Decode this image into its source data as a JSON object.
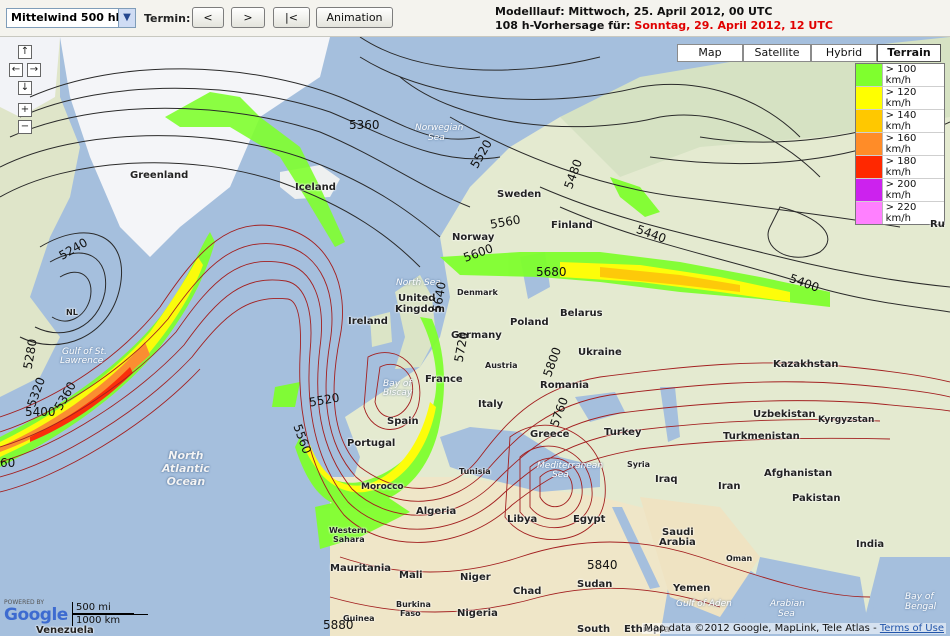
{
  "toolbar": {
    "level_select": "Mittelwind 500 hPa",
    "termin_label": "Termin:",
    "btn_prev": "<",
    "btn_next": ">",
    "btn_first": "|<",
    "btn_animation": "Animation"
  },
  "run_info": {
    "line1": "Modelllauf: Mittwoch, 25. April 2012, 00 UTC",
    "line2_prefix": "108 h-Vorhersage für:",
    "line2_date": "Sonntag, 29. April 2012, 12 UTC"
  },
  "map_types": [
    "Map",
    "Satellite",
    "Hybrid",
    "Terrain"
  ],
  "map_type_active": "Terrain",
  "legend": [
    {
      "label": "> 100 km/h",
      "color": "#7fff2e"
    },
    {
      "label": "> 120 km/h",
      "color": "#ffff00"
    },
    {
      "label": "> 140 km/h",
      "color": "#ffc800"
    },
    {
      "label": "> 160 km/h",
      "color": "#ff8c28"
    },
    {
      "label": "> 180 km/h",
      "color": "#ff2800"
    },
    {
      "label": "> 200 km/h",
      "color": "#cc22ee"
    },
    {
      "label": "> 220 km/h",
      "color": "#ff80ff"
    }
  ],
  "nav_controls": {
    "up": "↑",
    "left": "←",
    "right": "→",
    "down": "↓",
    "zoom_in": "+",
    "zoom_out": "−"
  },
  "places": {
    "greenland": "Greenland",
    "iceland": "Iceland",
    "norway": "Norway",
    "sweden": "Sweden",
    "finland": "Finland",
    "denmark": "Denmark",
    "ireland": "Ireland",
    "uk": "United Kingdom",
    "germany": "Germany",
    "poland": "Poland",
    "belarus": "Belarus",
    "ukraine": "Ukraine",
    "france": "France",
    "austria": "Austria",
    "romania": "Romania",
    "italy": "Italy",
    "spain": "Spain",
    "portugal": "Portugal",
    "greece": "Greece",
    "turkey": "Turkey",
    "tunisia": "Tunisia",
    "morocco": "Morocco",
    "algeria": "Algeria",
    "libya": "Libya",
    "egypt": "Egypt",
    "syria": "Syria",
    "iraq": "Iraq",
    "iran": "Iran",
    "kazakhstan": "Kazakhstan",
    "uzbekistan": "Uzbekistan",
    "kyrgyzstan": "Kyrgyzstan",
    "turkmenistan": "Turkmenistan",
    "afghanistan": "Afghanistan",
    "pakistan": "Pakistan",
    "india": "India",
    "saudi": "Saudi\nArabia",
    "oman": "Oman",
    "yemen": "Yemen",
    "mauritania": "Mauritania",
    "mali": "Mali",
    "niger": "Niger",
    "chad": "Chad",
    "sudan": "Sudan",
    "western_sahara": "Western\nSahara",
    "burkina": "Burkina\nFaso",
    "nigeria": "Nigeria",
    "guinea": "Guinea",
    "south": "South",
    "ethiopia": "Ethiopia",
    "venezuela": "Venezuela",
    "nl": "NL",
    "ru": "Ru"
  },
  "seas": {
    "norwegian": "Norwegian\nSea",
    "north_sea": "North Sea",
    "biscay": "Bay of\nBiscay",
    "mediterranean": "Mediterranean\nSea",
    "gulf_st": "Gulf of St.\nLawrence",
    "gulf_aden": "Gulf of Aden",
    "arabian": "Arabian\nSea",
    "bengal": "Bay of\nBengal"
  },
  "ocean": "North\nAtlantic\nOcean",
  "contour_labels": [
    "5360",
    "5520",
    "5480",
    "5440",
    "5400",
    "5240",
    "5280",
    "5320",
    "5360",
    "5400",
    "5560",
    "5600",
    "5680",
    "5640",
    "5720",
    "5800",
    "5760",
    "5520",
    "5560",
    "5840",
    "5880",
    "5560",
    "60",
    "5400"
  ],
  "scale": {
    "mi": "500 mi",
    "km": "1000 km"
  },
  "google": {
    "powered": "POWERED BY",
    "logo": "Google"
  },
  "attribution": {
    "text": "Map data ©2012 Google, MapLink, Tele Atlas - ",
    "terms": "Terms of Use"
  },
  "colors": {
    "ocean": "#a5bfdd",
    "land": "#e6ebd3",
    "ice": "#f7f8fb",
    "contour_dark": "#2a2a2a",
    "contour_red": "#a32020"
  }
}
